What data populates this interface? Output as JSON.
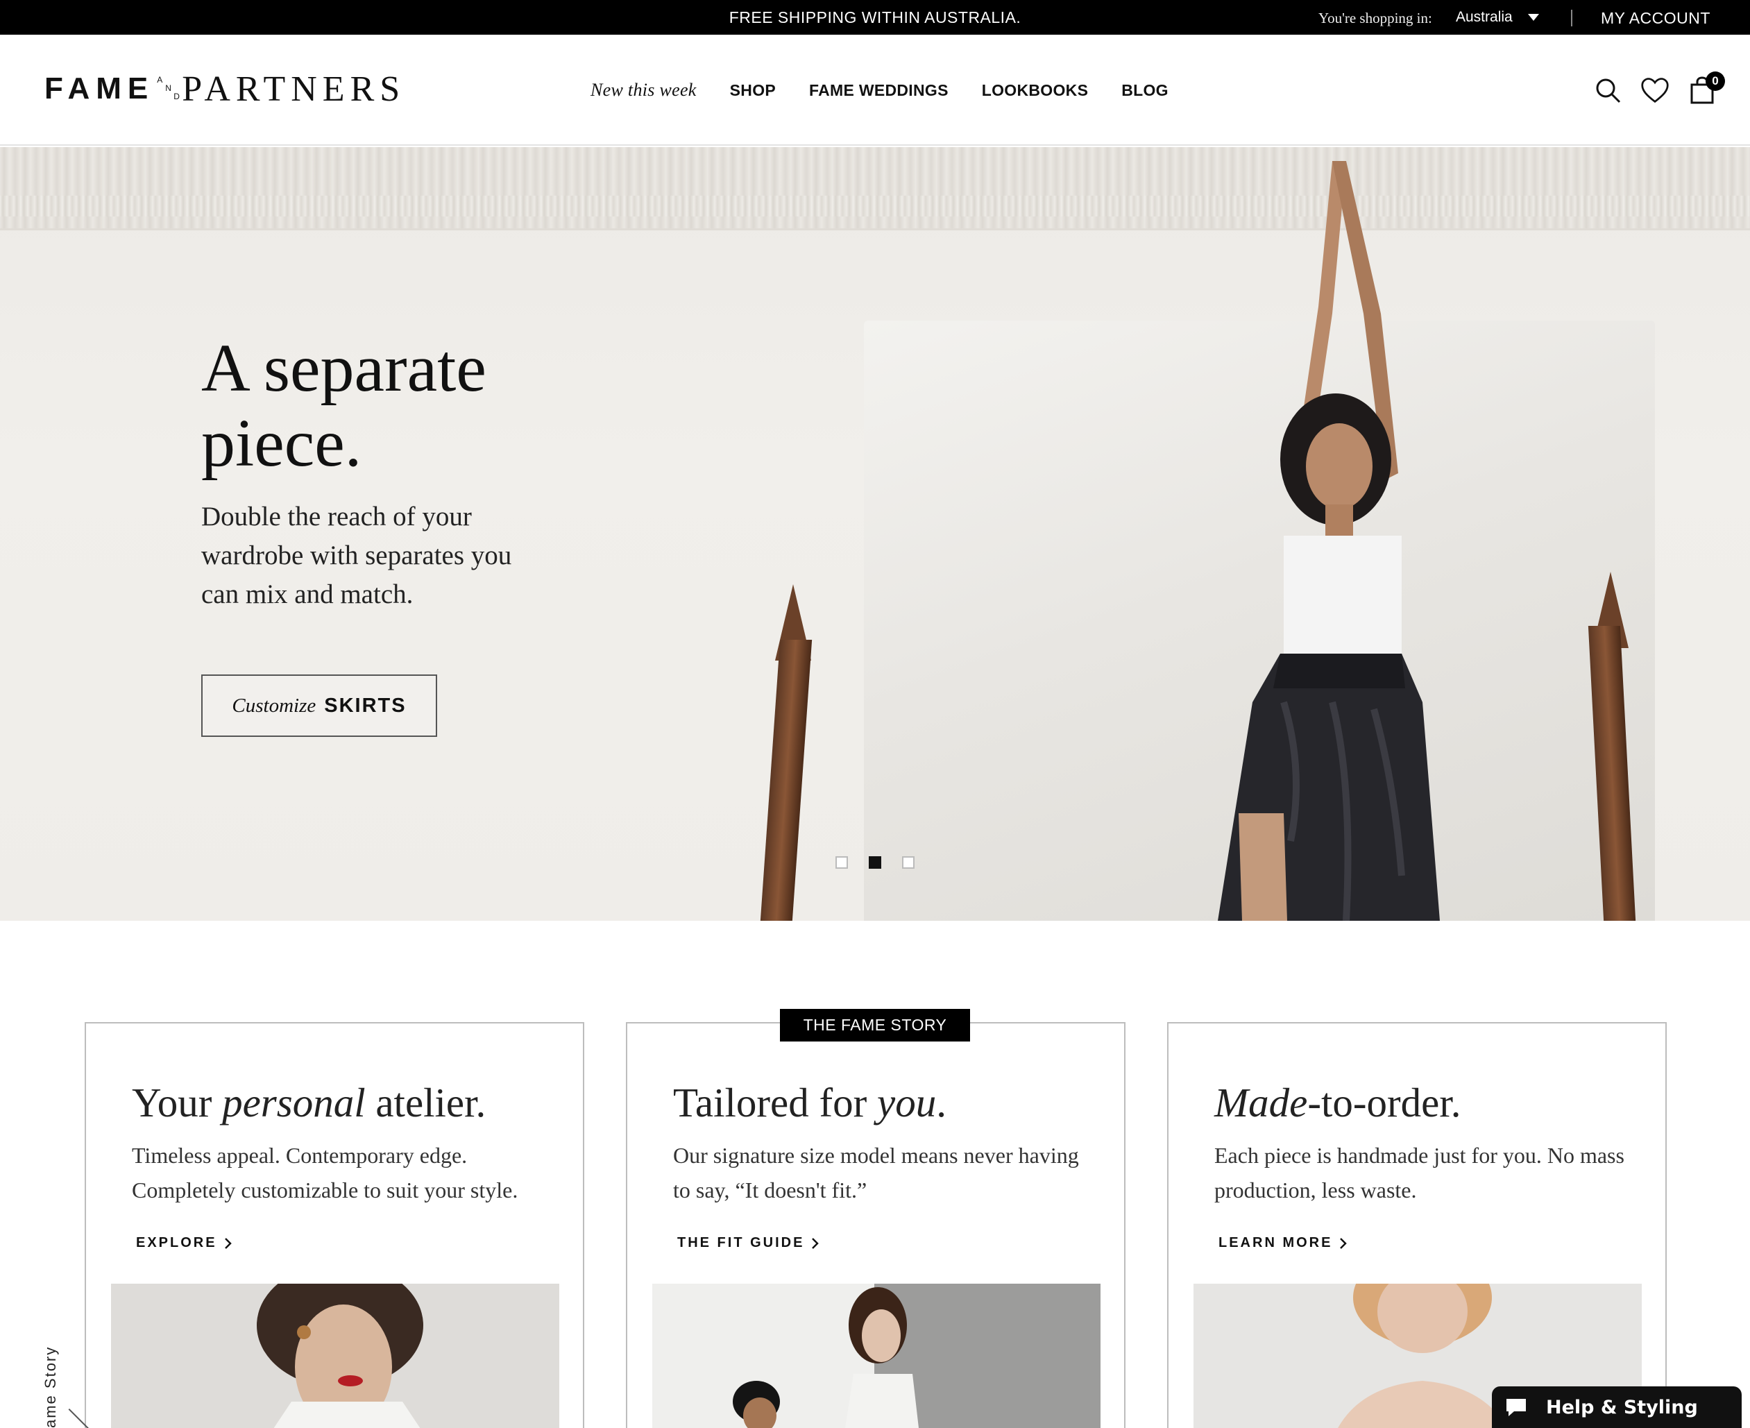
{
  "topbar": {
    "promo": "FREE SHIPPING WITHIN AUSTRALIA.",
    "shopping_in_label": "You're shopping in:",
    "country": "Australia",
    "account": "MY ACCOUNT"
  },
  "header": {
    "logo": {
      "fame": "FAME",
      "and_a": "A",
      "and_n": "N",
      "and_d": "D",
      "partners": "PARTNERS"
    },
    "nav": [
      "New this week",
      "SHOP",
      "FAME WEDDINGS",
      "LOOKBOOKS",
      "BLOG"
    ],
    "cart_count": "0",
    "icons": [
      "search-icon",
      "heart-icon",
      "shopping-bag-icon"
    ]
  },
  "hero": {
    "title": "A separate piece.",
    "subtitle": "Double the reach of your wardrobe with separates you can mix and match.",
    "cta_italic": "Customize",
    "cta_bold": "SKIRTS",
    "slides": 3,
    "active_slide": 2
  },
  "story": {
    "tag": "THE FAME STORY",
    "cards": [
      {
        "title_a": "Your ",
        "title_i": "personal",
        "title_b": " atelier.",
        "body": "Timeless appeal. Contemporary edge. Completely customizable to suit your style.",
        "link": "EXPLORE"
      },
      {
        "title_a": "Tailored for ",
        "title_i": "you",
        "title_b": ".",
        "body": "Our signature size model means never having to say, “It doesn't fit.”",
        "link": "THE FIT GUIDE"
      },
      {
        "title_a": "",
        "title_i": "Made",
        "title_b": "-to-order.",
        "body": "Each piece is handmade just for you. No mass production, less waste.",
        "link": "LEARN MORE"
      }
    ]
  },
  "side_label": "ame Story",
  "help_widget": "Help & Styling",
  "colors": {
    "bar": "#000000",
    "text": "#111111",
    "border": "#bdbdbd"
  }
}
